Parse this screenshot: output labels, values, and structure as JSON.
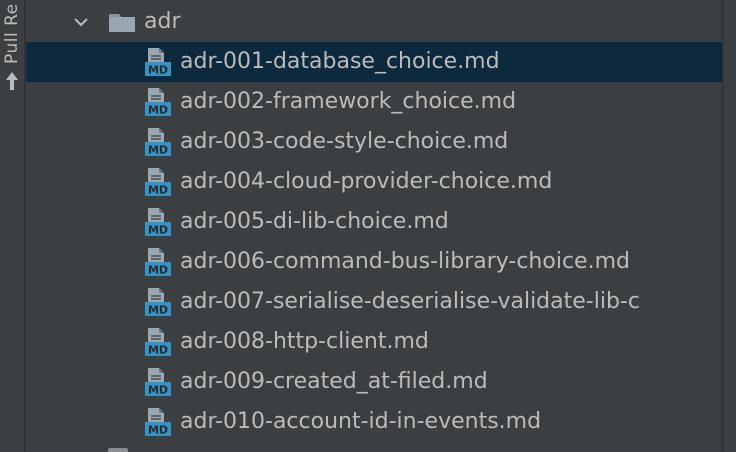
{
  "tool_strip": {
    "label": "Pull Re",
    "icon": "arrow-up-icon"
  },
  "folder": {
    "name": "adr",
    "expanded": true,
    "icon": "folder-icon"
  },
  "files": [
    {
      "name": "adr-001-database_choice.md",
      "selected": true
    },
    {
      "name": "adr-002-framework_choice.md",
      "selected": false
    },
    {
      "name": "adr-003-code-style-choice.md",
      "selected": false
    },
    {
      "name": "adr-004-cloud-provider-choice.md",
      "selected": false
    },
    {
      "name": "adr-005-di-lib-choice.md",
      "selected": false
    },
    {
      "name": "adr-006-command-bus-library-choice.md",
      "selected": false
    },
    {
      "name": "adr-007-serialise-deserialise-validate-lib-c",
      "selected": false
    },
    {
      "name": "adr-008-http-client.md",
      "selected": false
    },
    {
      "name": "adr-009-created_at-filed.md",
      "selected": false
    },
    {
      "name": "adr-010-account-id-in-events.md",
      "selected": false
    }
  ],
  "file_icon": {
    "name": "markdown-file-icon",
    "badge_text": "MD",
    "badge_color": "#3592c4",
    "doc_color": "#9aa7b0"
  },
  "colors": {
    "panel_bg": "#3c3f41",
    "selection_bg": "#0d293e",
    "text": "#bbbbbb"
  }
}
